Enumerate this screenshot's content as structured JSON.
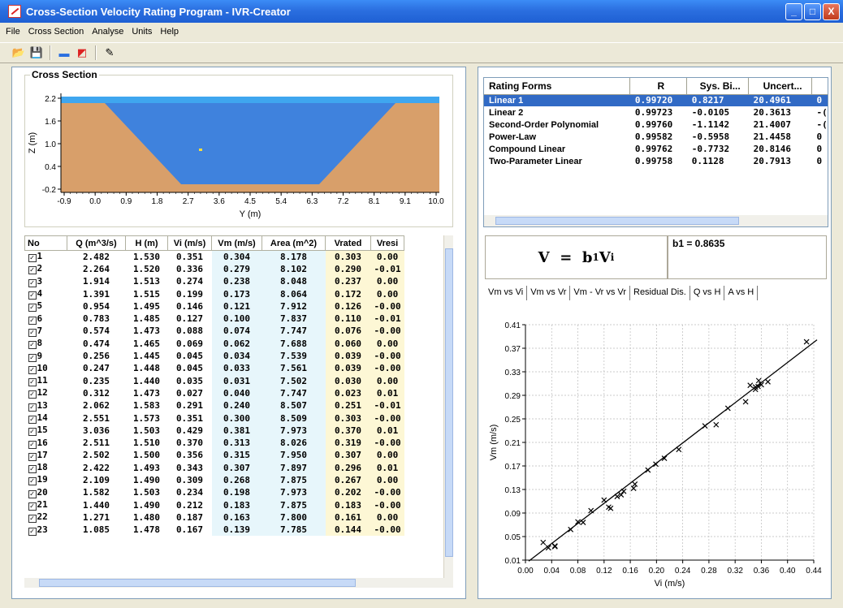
{
  "window": {
    "title": "Cross-Section Velocity Rating Program - IVR-Creator",
    "controls": [
      "_",
      "□",
      "X"
    ]
  },
  "menu": [
    "File",
    "Cross Section",
    "Analyse",
    "Units",
    "Help"
  ],
  "toolbar": [
    {
      "name": "open-icon",
      "glyph": "📂"
    },
    {
      "name": "save-icon",
      "glyph": "💾"
    },
    {
      "name": "cross-section-icon",
      "glyph": "▬"
    },
    {
      "name": "rating-chart-icon",
      "glyph": "◩"
    },
    {
      "name": "tools-icon",
      "glyph": "✎"
    }
  ],
  "cross_section": {
    "title": "Cross Section",
    "ylabel": "Z (m)",
    "xlabel": "Y (m)",
    "y_ticks": [
      "2.2",
      "1.6",
      "1.0",
      "0.4",
      "-0.2"
    ],
    "x_ticks": [
      "-0.9",
      "0.0",
      "0.9",
      "1.8",
      "2.7",
      "3.6",
      "4.5",
      "5.4",
      "6.3",
      "7.2",
      "8.1",
      "9.1",
      "10.0"
    ],
    "colors": {
      "soil": "#d89f6a",
      "water_deep": "#3f82dd",
      "water_surface": "#3fa6ef",
      "marker": "#ffde3a"
    }
  },
  "data_table": {
    "columns": [
      "No",
      "Q (m^3/s)",
      "H (m)",
      "Vi (m/s)",
      "Vm (m/s)",
      "Area (m^2)",
      "Vrated",
      "Vresi"
    ],
    "rows": [
      [
        "1",
        "2.482",
        "1.530",
        "0.351",
        "0.304",
        "8.178",
        "0.303",
        "0.00"
      ],
      [
        "2",
        "2.264",
        "1.520",
        "0.336",
        "0.279",
        "8.102",
        "0.290",
        "-0.01"
      ],
      [
        "3",
        "1.914",
        "1.513",
        "0.274",
        "0.238",
        "8.048",
        "0.237",
        "0.00"
      ],
      [
        "4",
        "1.391",
        "1.515",
        "0.199",
        "0.173",
        "8.064",
        "0.172",
        "0.00"
      ],
      [
        "5",
        "0.954",
        "1.495",
        "0.146",
        "0.121",
        "7.912",
        "0.126",
        "-0.00"
      ],
      [
        "6",
        "0.783",
        "1.485",
        "0.127",
        "0.100",
        "7.837",
        "0.110",
        "-0.01"
      ],
      [
        "7",
        "0.574",
        "1.473",
        "0.088",
        "0.074",
        "7.747",
        "0.076",
        "-0.00"
      ],
      [
        "8",
        "0.474",
        "1.465",
        "0.069",
        "0.062",
        "7.688",
        "0.060",
        "0.00"
      ],
      [
        "9",
        "0.256",
        "1.445",
        "0.045",
        "0.034",
        "7.539",
        "0.039",
        "-0.00"
      ],
      [
        "10",
        "0.247",
        "1.448",
        "0.045",
        "0.033",
        "7.561",
        "0.039",
        "-0.00"
      ],
      [
        "11",
        "0.235",
        "1.440",
        "0.035",
        "0.031",
        "7.502",
        "0.030",
        "0.00"
      ],
      [
        "12",
        "0.312",
        "1.473",
        "0.027",
        "0.040",
        "7.747",
        "0.023",
        "0.01"
      ],
      [
        "13",
        "2.062",
        "1.583",
        "0.291",
        "0.240",
        "8.507",
        "0.251",
        "-0.01"
      ],
      [
        "14",
        "2.551",
        "1.573",
        "0.351",
        "0.300",
        "8.509",
        "0.303",
        "-0.00"
      ],
      [
        "15",
        "3.036",
        "1.503",
        "0.429",
        "0.381",
        "7.973",
        "0.370",
        "0.01"
      ],
      [
        "16",
        "2.511",
        "1.510",
        "0.370",
        "0.313",
        "8.026",
        "0.319",
        "-0.00"
      ],
      [
        "17",
        "2.502",
        "1.500",
        "0.356",
        "0.315",
        "7.950",
        "0.307",
        "0.00"
      ],
      [
        "18",
        "2.422",
        "1.493",
        "0.343",
        "0.307",
        "7.897",
        "0.296",
        "0.01"
      ],
      [
        "19",
        "2.109",
        "1.490",
        "0.309",
        "0.268",
        "7.875",
        "0.267",
        "0.00"
      ],
      [
        "20",
        "1.582",
        "1.503",
        "0.234",
        "0.198",
        "7.973",
        "0.202",
        "-0.00"
      ],
      [
        "21",
        "1.440",
        "1.490",
        "0.212",
        "0.183",
        "7.875",
        "0.183",
        "-0.00"
      ],
      [
        "22",
        "1.271",
        "1.480",
        "0.187",
        "0.163",
        "7.800",
        "0.161",
        "0.00"
      ],
      [
        "23",
        "1.085",
        "1.478",
        "0.167",
        "0.139",
        "7.785",
        "0.144",
        "-0.00"
      ]
    ]
  },
  "rating_forms": {
    "columns": [
      "Rating Forms",
      "R",
      "Sys. Bi...",
      "Uncert..."
    ],
    "rows": [
      [
        "Linear 1",
        "0.99720",
        "0.8217",
        "20.4961",
        "0"
      ],
      [
        "Linear 2",
        "0.99723",
        "-0.0105",
        "20.3613",
        "-("
      ],
      [
        "Second-Order Polynomial",
        "0.99760",
        "-1.1142",
        "21.4007",
        "-("
      ],
      [
        "Power-Law",
        "0.99582",
        "-0.5958",
        "21.4458",
        "0"
      ],
      [
        "Compound Linear",
        "0.99762",
        "-0.7732",
        "20.8146",
        "0"
      ],
      [
        "Two-Parameter Linear",
        "0.99758",
        "0.1128",
        "20.7913",
        "0"
      ]
    ]
  },
  "equation": {
    "v": "V",
    "eq": "=",
    "b": "b",
    "b_sub": "1",
    "vi": "V",
    "vi_sub": "i",
    "coef": "b1 = 0.8635"
  },
  "chart_tabs": [
    "Vm vs Vi",
    "Vm vs Vr",
    "Vm - Vr vs Vr",
    "Residual Dis.",
    "Q vs H",
    "A vs H"
  ],
  "chart_data": {
    "type": "scatter",
    "xlabel": "Vi (m/s)",
    "ylabel": "Vm (m/s)",
    "xlim": [
      0.0,
      0.44
    ],
    "ylim": [
      0.01,
      0.41
    ],
    "x_ticks": [
      0.0,
      0.04,
      0.08,
      0.12,
      0.16,
      0.2,
      0.24,
      0.28,
      0.32,
      0.36,
      0.4,
      0.44
    ],
    "y_ticks": [
      0.01,
      0.05,
      0.09,
      0.13,
      0.17,
      0.21,
      0.25,
      0.29,
      0.33,
      0.37,
      0.41
    ],
    "grid": true,
    "points": [
      [
        0.351,
        0.304
      ],
      [
        0.336,
        0.279
      ],
      [
        0.274,
        0.238
      ],
      [
        0.199,
        0.173
      ],
      [
        0.146,
        0.121
      ],
      [
        0.127,
        0.1
      ],
      [
        0.088,
        0.074
      ],
      [
        0.069,
        0.062
      ],
      [
        0.045,
        0.034
      ],
      [
        0.045,
        0.033
      ],
      [
        0.035,
        0.031
      ],
      [
        0.027,
        0.04
      ],
      [
        0.291,
        0.24
      ],
      [
        0.351,
        0.3
      ],
      [
        0.429,
        0.381
      ],
      [
        0.37,
        0.313
      ],
      [
        0.356,
        0.315
      ],
      [
        0.343,
        0.307
      ],
      [
        0.309,
        0.268
      ],
      [
        0.234,
        0.198
      ],
      [
        0.212,
        0.183
      ],
      [
        0.187,
        0.163
      ],
      [
        0.167,
        0.139
      ],
      [
        0.12,
        0.112
      ],
      [
        0.13,
        0.098
      ],
      [
        0.14,
        0.118
      ],
      [
        0.15,
        0.127
      ],
      [
        0.165,
        0.132
      ],
      [
        0.1,
        0.094
      ],
      [
        0.08,
        0.075
      ],
      [
        0.355,
        0.305
      ],
      [
        0.36,
        0.308
      ]
    ],
    "fit_line": {
      "slope": 0.8635,
      "intercept": 0.0
    },
    "x_extent": [
      0.0,
      0.445
    ]
  }
}
